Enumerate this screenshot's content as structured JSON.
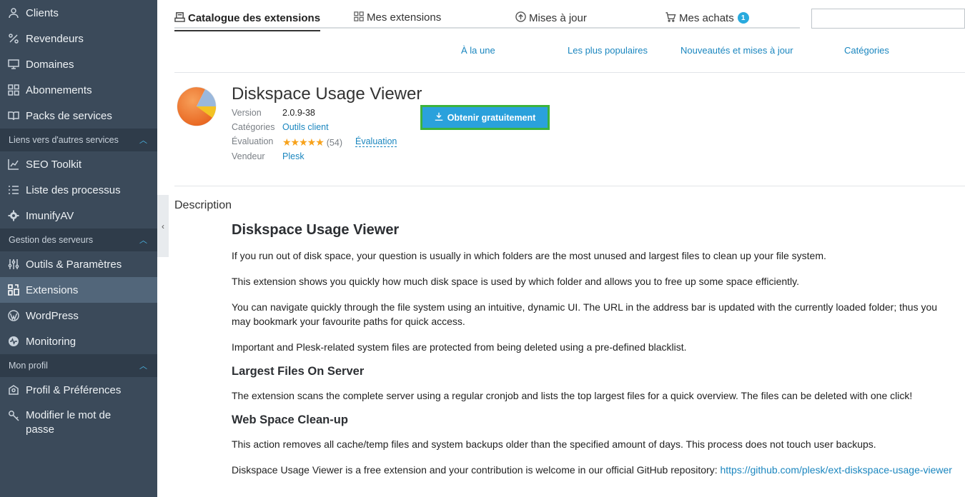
{
  "sidebar": {
    "items_top": [
      {
        "label": "Clients",
        "icon": "user-icon"
      },
      {
        "label": "Revendeurs",
        "icon": "percent-icon"
      },
      {
        "label": "Domaines",
        "icon": "monitor-icon"
      },
      {
        "label": "Abonnements",
        "icon": "grid-icon"
      },
      {
        "label": "Packs de services",
        "icon": "book-icon"
      }
    ],
    "section1": "Liens vers d'autres services",
    "items_links": [
      {
        "label": "SEO Toolkit",
        "icon": "chart-icon"
      },
      {
        "label": "Liste des processus",
        "icon": "list-icon"
      },
      {
        "label": "ImunifyAV",
        "icon": "gear-icon"
      }
    ],
    "section2": "Gestion des serveurs",
    "items_server": [
      {
        "label": "Outils & Paramètres",
        "icon": "sliders-icon"
      },
      {
        "label": "Extensions",
        "icon": "extensions-icon"
      },
      {
        "label": "WordPress",
        "icon": "wordpress-icon"
      },
      {
        "label": "Monitoring",
        "icon": "pulse-icon"
      }
    ],
    "section3": "Mon profil",
    "items_profile": [
      {
        "label": "Profil & Préférences",
        "icon": "profile-icon"
      },
      {
        "label": "Modifier le mot de passe",
        "icon": "key-icon"
      }
    ]
  },
  "tabs": {
    "catalogue": "Catalogue des extensions",
    "mine": "Mes extensions",
    "updates": "Mises à jour",
    "purchases": "Mes achats",
    "purchases_badge": "1"
  },
  "subnav": {
    "featured": "À la une",
    "popular": "Les plus populaires",
    "new": "Nouveautés et mises à jour",
    "categories": "Catégories"
  },
  "product": {
    "title": "Diskspace Usage Viewer",
    "version_label": "Version",
    "version": "2.0.9-38",
    "categories_label": "Catégories",
    "category": "Outils client",
    "rating_label": "Évaluation",
    "rating_stars": "★★★★★",
    "rating_count": "(54)",
    "rate_link": "Évaluation",
    "vendor_label": "Vendeur",
    "vendor": "Plesk",
    "get_button": "Obtenir gratuitement"
  },
  "description": {
    "section_title": "Description",
    "heading": "Diskspace Usage Viewer",
    "p1": "If you run out of disk space, your question is usually in which folders are the most unused and largest files to clean up your file system.",
    "p2": "This extension shows you quickly how much disk space is used by which folder and allows you to free up some space efficiently.",
    "p3": "You can navigate quickly through the file system using an intuitive, dynamic UI. The URL in the address bar is updated with the currently loaded folder; thus you may bookmark your favourite paths for quick access.",
    "p4": "Important and Plesk-related system files are protected from being deleted using a pre-defined blacklist.",
    "h_largest": "Largest Files On Server",
    "p5": "The extension scans the complete server using a regular cronjob and lists the top largest files for a quick overview. The files can be deleted with one click!",
    "h_cleanup": "Web Space Clean-up",
    "p6": "This action removes all cache/temp files and system backups older than the specified amount of days. This process does not touch user backups.",
    "p7": "Diskspace Usage Viewer is a free extension and your contribution is welcome in our official GitHub repository: ",
    "github_link": "https://github.com/plesk/ext-diskspace-usage-viewer"
  },
  "colors": {
    "sidebar_bg": "#3b4a5a",
    "accent": "#2aa1dc",
    "link": "#1a86bf",
    "button_highlight": "#3db33d"
  }
}
